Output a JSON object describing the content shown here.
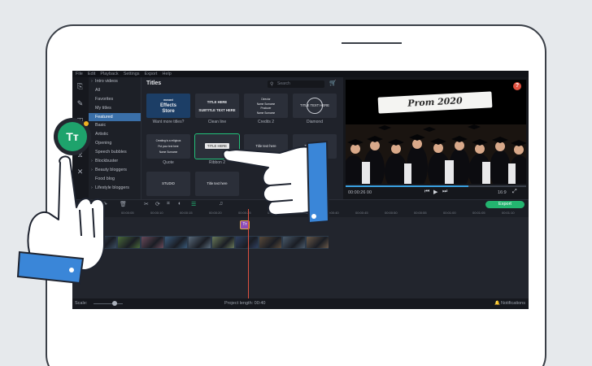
{
  "menu": [
    "File",
    "Edit",
    "Playback",
    "Settings",
    "Export",
    "Help"
  ],
  "categories": [
    {
      "label": "Intro videos",
      "arrow": true
    },
    {
      "label": "All"
    },
    {
      "label": "Favorites"
    },
    {
      "label": "My titles"
    },
    {
      "label": "Featured",
      "active": true
    },
    {
      "label": "Basic"
    },
    {
      "label": "Artistic"
    },
    {
      "label": "Opening"
    },
    {
      "label": "Speech bubbles"
    },
    {
      "label": "Blockbuster",
      "arrow": true
    },
    {
      "label": "Beauty bloggers",
      "arrow": true
    },
    {
      "label": "Food blog"
    },
    {
      "label": "Lifestyle bloggers",
      "arrow": true
    }
  ],
  "gallery": {
    "title": "Titles",
    "search_placeholder": "Search",
    "thumbs": [
      {
        "label": "Want more titles?",
        "lines": [
          "movavi",
          "Effects",
          "Store"
        ]
      },
      {
        "label": "Clean line",
        "lines": [
          "TITLE HERE",
          "SUBTITLE TEXT HERE"
        ]
      },
      {
        "label": "Credits 2",
        "lines": [
          "Director",
          "Name Surname",
          "Producer",
          "Name Surname"
        ]
      },
      {
        "label": "Diamond",
        "lines": [
          "TITLE TEXT HERE"
        ]
      },
      {
        "label": "Quote",
        "lines": [
          "Creating is a religious",
          "Put your text here",
          "Name Surname"
        ]
      },
      {
        "label": "Ribbon 2",
        "lines": [
          "TITLE HERE"
        ]
      },
      {
        "label": "",
        "lines": [
          "Title text here"
        ]
      },
      {
        "label": "Title text",
        "lines": [
          "Title text here"
        ]
      },
      {
        "label": "",
        "lines": [
          "STUDIO"
        ]
      },
      {
        "label": "",
        "lines": [
          "Title text here"
        ]
      }
    ]
  },
  "preview": {
    "banner_text": "Prom 2020",
    "time": "00:00:26 00",
    "ratio": "16:9",
    "progress": 0.68
  },
  "timeline": {
    "export_label": "Export",
    "ticks": [
      "00:00:00",
      "00:00:05",
      "00:00:10",
      "00:00:15",
      "00:00:20",
      "00:00:25",
      "00:00:30",
      "00:00:35",
      "00:00:40",
      "00:00:45",
      "00:00:50",
      "00:00:55",
      "00:01:00",
      "00:01:05",
      "00:01:10",
      "00:01:15"
    ],
    "title_clip_label": "Tт",
    "clip_colors": [
      "#3b4d62",
      "#4a6a3a",
      "#6a4a5a",
      "#3a5a7a",
      "#5a6a7a",
      "#6a7a5a",
      "#2f3f5f",
      "#5a4a3a",
      "#4a5a6a",
      "#6a5a4a"
    ]
  },
  "status": {
    "scale_label": "Scale:",
    "project_length": "Project length: 00:40",
    "notifications": "Notifications"
  },
  "badge": {
    "label": "Tт"
  },
  "colors": {
    "accent": "#23b46f",
    "selection": "#3a6fa8",
    "playhead": "#e0503f",
    "title_clip": "#8c4db8"
  }
}
